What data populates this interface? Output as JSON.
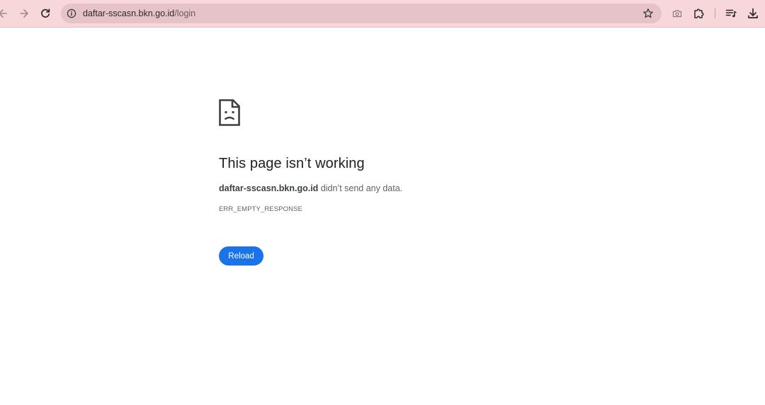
{
  "browser": {
    "url_host": "daftar-sscasn.bkn.go.id",
    "url_path": "/login",
    "icons": {
      "back": "arrow-left-icon",
      "forward": "arrow-right-icon",
      "reload": "reload-icon",
      "site_info": "info-icon",
      "bookmark": "star-icon",
      "screenshot": "camera-icon",
      "extensions": "puzzle-icon",
      "media": "media-controls-icon",
      "downloads": "download-icon"
    },
    "toolbar_color": "#f8d7db",
    "omnibox_color": "#e6c3c8"
  },
  "error_page": {
    "icon": "sad-page-icon",
    "title": "This page isn’t working",
    "host": "daftar-sscasn.bkn.go.id",
    "message_suffix": " didn’t send any data.",
    "error_code": "ERR_EMPTY_RESPONSE",
    "reload_label": "Reload",
    "accent_color": "#1a73e8"
  }
}
